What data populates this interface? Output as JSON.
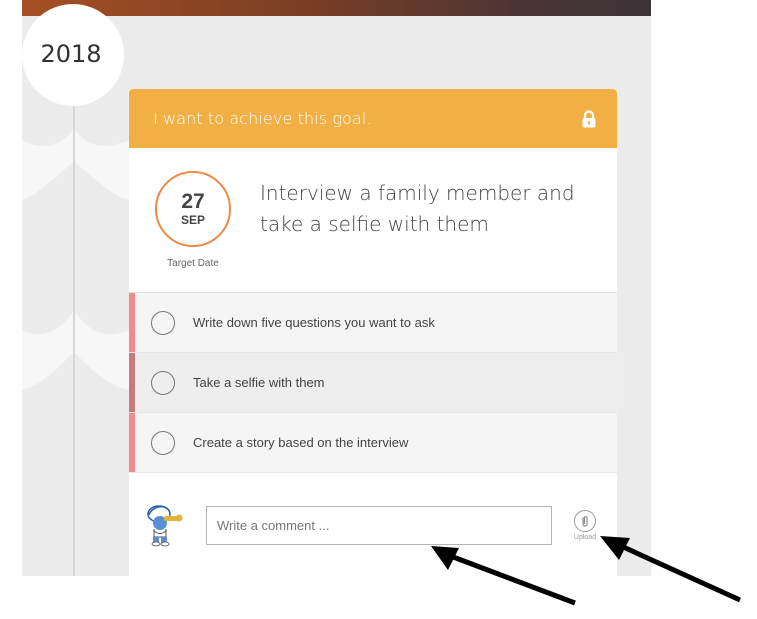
{
  "timeline": {
    "year": "2018"
  },
  "goal_card": {
    "header_title": "I want to achieve this goal.",
    "header_icon": "lock-icon",
    "header_color": "#f2b044",
    "date": {
      "day": "27",
      "month": "SEP",
      "label": "Target Date"
    },
    "title": "Interview a family member and take a selfie with them",
    "tasks": [
      {
        "label": "Write down five questions you want to ask",
        "stripe_color": "#f28b8b",
        "completed": false
      },
      {
        "label": "Take a selfie with them",
        "stripe_color": "#c97a7a",
        "completed": false
      },
      {
        "label": "Create a story based on the interview",
        "stripe_color": "#f28b8b",
        "completed": false
      }
    ],
    "comment": {
      "placeholder": "Write a comment ...",
      "value": "",
      "avatar_icon": "smurf-avatar"
    },
    "upload": {
      "label": "Upload",
      "icon": "paperclip-icon"
    }
  },
  "colors": {
    "accent_orange": "#f2b044",
    "date_ring": "#ec8a46",
    "background": "#ececec"
  }
}
